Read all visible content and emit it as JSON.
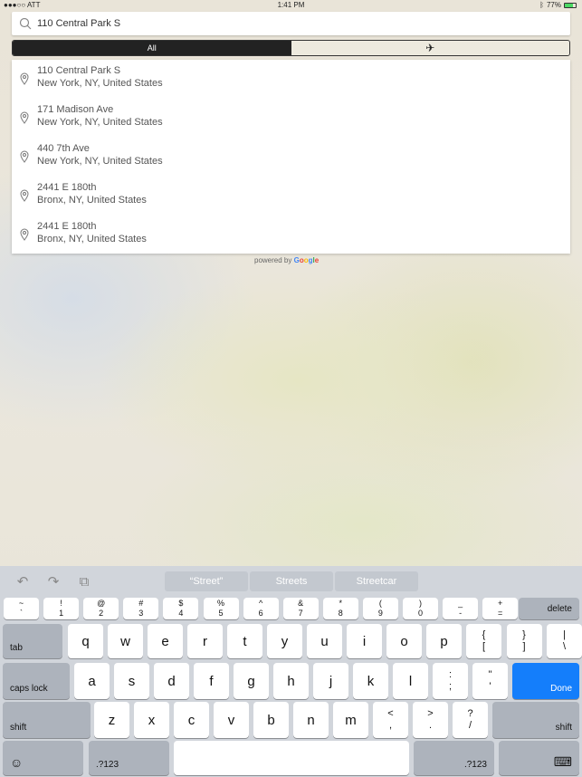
{
  "status_bar": {
    "carrier": "●●●○○ ATT",
    "wifi_icon": "wifi-icon",
    "time": "1:41 PM",
    "bluetooth_icon": "bluetooth-icon",
    "battery_percent": "77%",
    "battery_level": 0.77
  },
  "search": {
    "value": "110 Central Park S",
    "icon": "search-icon"
  },
  "segments": [
    {
      "label": "All",
      "selected": true
    },
    {
      "label": "✈",
      "icon": "airplane-icon",
      "selected": false
    }
  ],
  "results": [
    {
      "line1": "110 Central Park S",
      "line2": "New York, NY, United States"
    },
    {
      "line1": "171 Madison Ave",
      "line2": "New York, NY, United States"
    },
    {
      "line1": "440 7th Ave",
      "line2": "New York, NY, United States"
    },
    {
      "line1": "2441 E 180th",
      "line2": "Bronx, NY, United States"
    },
    {
      "line1": "2441 E 180th",
      "line2": "Bronx, NY, United States"
    }
  ],
  "powered_by": {
    "prefix": "powered by",
    "brand": [
      "G",
      "o",
      "o",
      "g",
      "l",
      "e"
    ],
    "brand_colors": [
      "#4285f4",
      "#ea4335",
      "#fbbc05",
      "#4285f4",
      "#34a853",
      "#ea4335"
    ]
  },
  "keyboard": {
    "toolbar": {
      "undo_icon": "↶",
      "redo_icon": "↷",
      "paste_icon": "⧉"
    },
    "suggestions": [
      "“Street”",
      "Streets",
      "Streetcar"
    ],
    "row1": [
      [
        "~",
        "`"
      ],
      [
        "!",
        "1"
      ],
      [
        "@",
        "2"
      ],
      [
        "#",
        "3"
      ],
      [
        "$",
        "4"
      ],
      [
        "%",
        "5"
      ],
      [
        "^",
        "6"
      ],
      [
        "&",
        "7"
      ],
      [
        "*",
        "8"
      ],
      [
        "(",
        "9"
      ],
      [
        ")",
        "0"
      ],
      [
        "_",
        "-"
      ],
      [
        "+",
        "="
      ]
    ],
    "delete": "delete",
    "tab": "tab",
    "row2": [
      "q",
      "w",
      "e",
      "r",
      "t",
      "y",
      "u",
      "i",
      "o",
      "p"
    ],
    "row2_sym": [
      [
        "{",
        "["
      ],
      [
        "}",
        "]"
      ],
      [
        "|",
        "\\"
      ]
    ],
    "caps": "caps lock",
    "row3": [
      "a",
      "s",
      "d",
      "f",
      "g",
      "h",
      "j",
      "k",
      "l"
    ],
    "row3_sym": [
      [
        ":",
        ";"
      ],
      [
        "\"",
        "'"
      ]
    ],
    "done": "Done",
    "shift": "shift",
    "row4": [
      "z",
      "x",
      "c",
      "v",
      "b",
      "n",
      "m"
    ],
    "row4_sym": [
      [
        "<",
        ","
      ],
      [
        ">",
        "."
      ],
      [
        "?",
        "/"
      ]
    ],
    "emoji": "☺",
    "numbers": ".?123",
    "hide_icon": "⌨"
  }
}
